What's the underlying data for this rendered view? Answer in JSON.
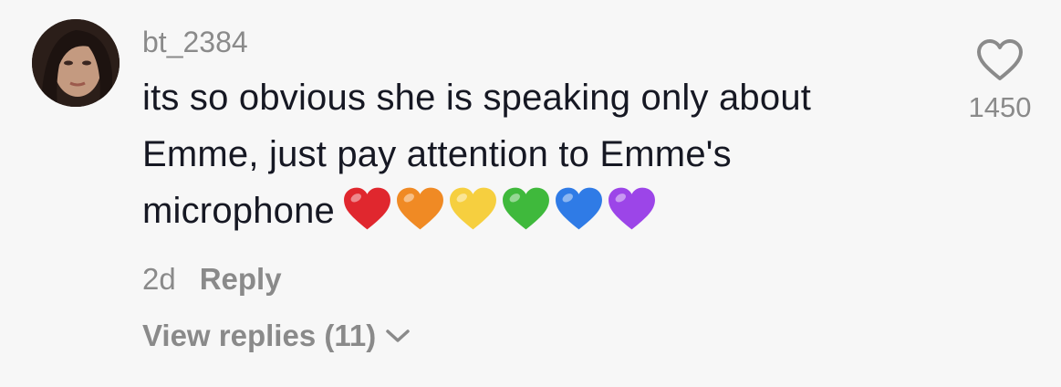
{
  "comment": {
    "username": "bt_2384",
    "text": "its so obvious she is speaking only about Emme, just pay attention to Emme's microphone",
    "emoji_hearts": [
      "red-heart",
      "orange-heart",
      "yellow-heart",
      "green-heart",
      "blue-heart",
      "purple-heart"
    ],
    "heart_colors": [
      "#e0272e",
      "#f08a24",
      "#f6cf3f",
      "#3fb93c",
      "#2f7be6",
      "#9c45e8"
    ],
    "age": "2d",
    "reply_label": "Reply",
    "view_replies_label": "View replies (11)",
    "like_count": "1450"
  },
  "colors": {
    "background": "#f7f7f7",
    "text": "#161823",
    "muted": "#8a8a8a"
  }
}
